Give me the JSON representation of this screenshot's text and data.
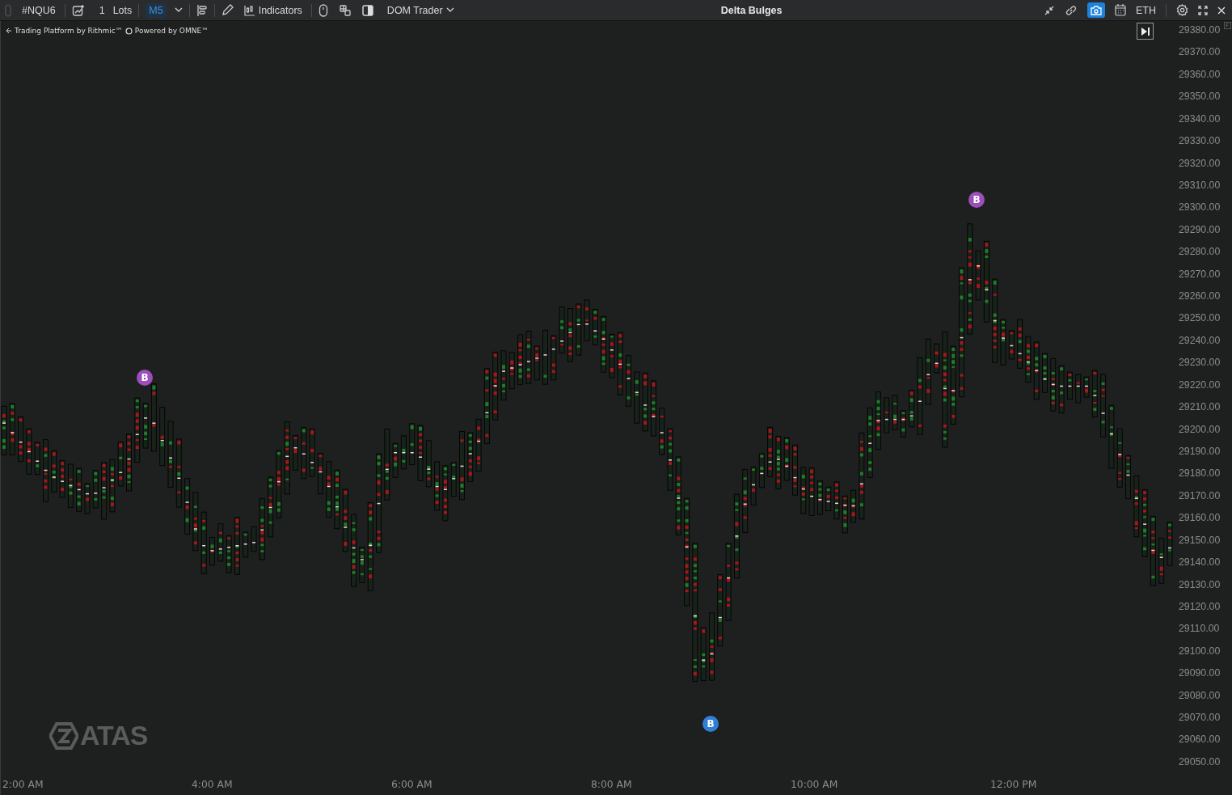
{
  "toolbar": {
    "symbol": "#NQU6",
    "quantity": "1",
    "quantity_unit": "Lots",
    "timeframe": {
      "label": "M5",
      "selected": true
    },
    "indicators_label": "Indicators",
    "dom_label": "DOM Trader",
    "title": "Delta Bulges",
    "session": "ETH",
    "camera_active": true
  },
  "chart": {
    "credits": "Trading Platform by Rithmic™",
    "powered_by": "Powered by OMNE™",
    "price_labels": [
      "29380.00",
      "29370.00",
      "29360.00",
      "29350.00",
      "29340.00",
      "29330.00",
      "29320.00",
      "29310.00",
      "29300.00",
      "29290.00",
      "29280.00",
      "29270.00",
      "29260.00",
      "29250.00",
      "29240.00",
      "29230.00",
      "29220.00",
      "29210.00",
      "29200.00",
      "29190.00",
      "29180.00",
      "29170.00",
      "29160.00",
      "29150.00",
      "29140.00",
      "29130.00",
      "29120.00",
      "29110.00",
      "29100.00",
      "29090.00",
      "29080.00",
      "29070.00",
      "29060.00",
      "29050.00"
    ],
    "time_labels": [
      "2:00 AM",
      "4:00 AM",
      "6:00 AM",
      "8:00 AM",
      "10:00 AM",
      "12:00 PM"
    ],
    "markers": [
      {
        "label": "B",
        "color": "#9c4fbb"
      },
      {
        "label": "B",
        "color": "#9c4fbb"
      },
      {
        "label": "B",
        "color": "#2f7fd6"
      }
    ],
    "logo_text": "ATAS"
  }
}
